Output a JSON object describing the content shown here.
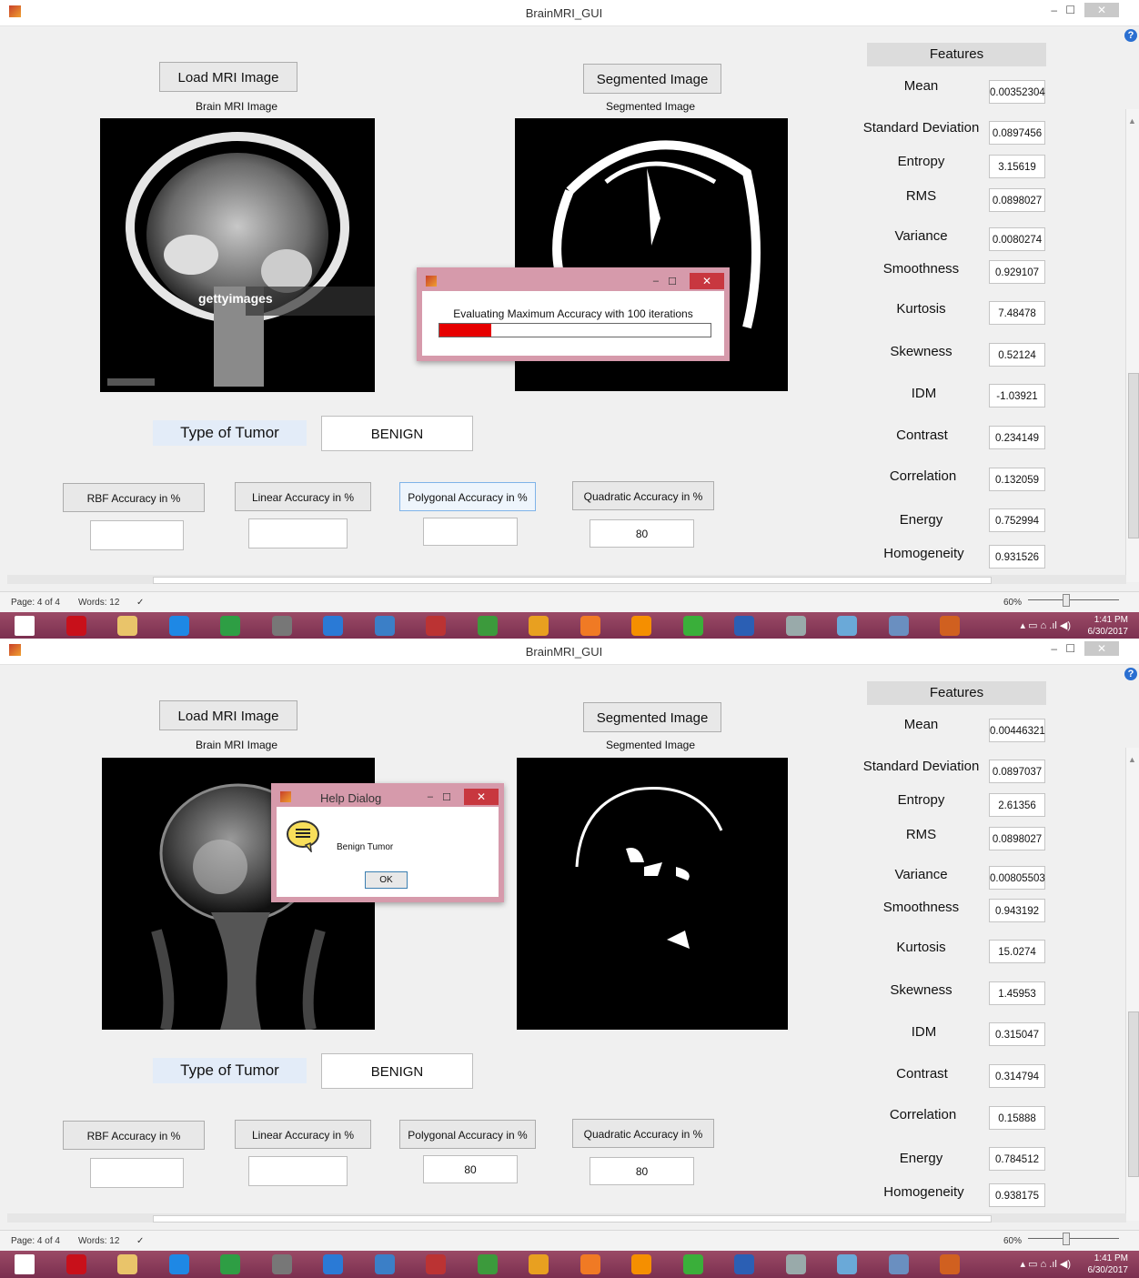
{
  "app": {
    "title": "BrainMRI_GUI"
  },
  "buttons": {
    "load": "Load MRI Image",
    "segmented": "Segmented Image",
    "rbf": "RBF Accuracy in %",
    "linear": "Linear Accuracy in %",
    "polygonal": "Polygonal Accuracy in %",
    "quadratic": "Quadratic Accuracy in %"
  },
  "labels": {
    "brain_mri": "Brain MRI Image",
    "segmented": "Segmented Image",
    "type_of_tumor": "Type of Tumor",
    "features": "Features"
  },
  "feature_names": {
    "mean": "Mean",
    "std": "Standard Deviation",
    "entropy": "Entropy",
    "rms": "RMS",
    "variance": "Variance",
    "smoothness": "Smoothness",
    "kurtosis": "Kurtosis",
    "skewness": "Skewness",
    "idm": "IDM",
    "contrast": "Contrast",
    "correlation": "Correlation",
    "energy": "Energy",
    "homogeneity": "Homogeneity"
  },
  "screen1": {
    "tumor_type": "BENIGN",
    "accuracy": {
      "rbf": "",
      "linear": "",
      "polygonal": "",
      "quadratic": "80"
    },
    "features": {
      "mean": "0.00352304",
      "std": "0.0897456",
      "entropy": "3.15619",
      "rms": "0.0898027",
      "variance": "0.0080274",
      "smoothness": "0.929107",
      "kurtosis": "7.48478",
      "skewness": "0.52124",
      "idm": "-1.03921",
      "contrast": "0.234149",
      "correlation": "0.132059",
      "energy": "0.752994",
      "homogeneity": "0.931526"
    },
    "watermark": "gettyimages",
    "progress_dialog": {
      "message": "Evaluating Maximum Accuracy with 100 iterations",
      "progress": 0.19
    }
  },
  "screen2": {
    "tumor_type": "BENIGN",
    "accuracy": {
      "rbf": "",
      "linear": "",
      "polygonal": "80",
      "quadratic": "80"
    },
    "features": {
      "mean": "0.00446321",
      "std": "0.0897037",
      "entropy": "2.61356",
      "rms": "0.0898027",
      "variance": "0.00805503",
      "smoothness": "0.943192",
      "kurtosis": "15.0274",
      "skewness": "1.45953",
      "idm": "0.315047",
      "contrast": "0.314794",
      "correlation": "0.15888",
      "energy": "0.784512",
      "homogeneity": "0.938175"
    },
    "help_dialog": {
      "title": "Help Dialog",
      "message": "Benign Tumor",
      "ok": "OK"
    }
  },
  "statusbar": {
    "page": "Page: 4 of 4",
    "words": "Words: 12",
    "zoom": "60%"
  },
  "taskbar": {
    "time": "1:41 PM",
    "date": "6/30/2017"
  },
  "icons": [
    "windows-start-icon",
    "acrobat-icon",
    "file-explorer-icon",
    "internet-explorer-icon",
    "store-icon",
    "network-icon",
    "media-player-icon",
    "video-icon",
    "sound-recorder-icon",
    "music-icon",
    "chrome-icon",
    "uc-browser-icon",
    "vlc-icon",
    "chat-icon",
    "word-icon",
    "snipping-tool-icon",
    "photo-viewer-icon",
    "photos-icon",
    "matlab-icon"
  ],
  "colors": {
    "progress": "#e60000",
    "taskbar": "#8a3a5a",
    "dialog_border": "#d69aab"
  }
}
